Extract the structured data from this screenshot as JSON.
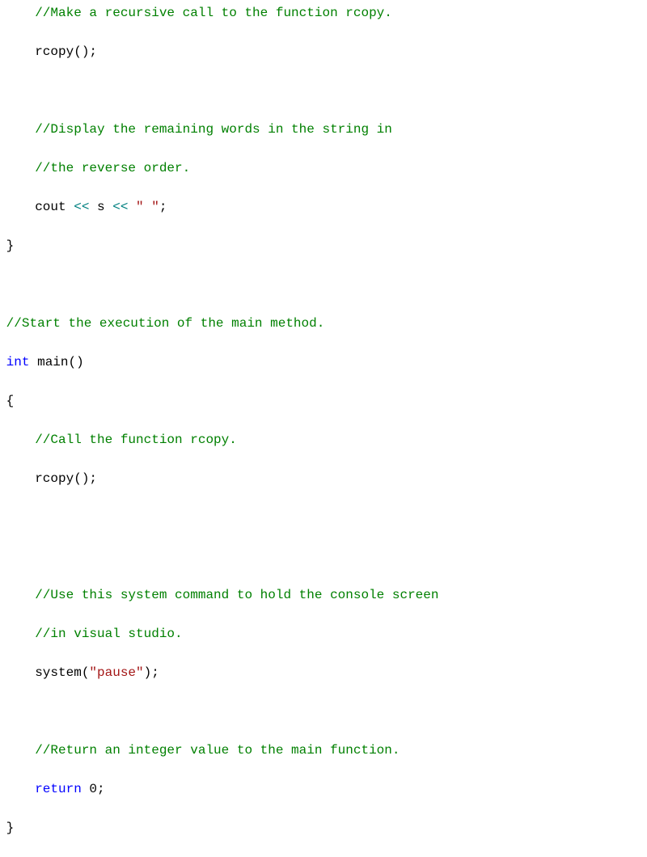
{
  "code": {
    "l1_comment": "//Make a recursive call to the function rcopy.",
    "l2_call": "rcopy",
    "l2_paren": "();",
    "l3_comment": "//Display the remaining words in the string in",
    "l4_comment": "//the reverse order.",
    "l5_cout": "cout ",
    "l5_op1": "<< ",
    "l5_s": "s ",
    "l5_op2": "<< ",
    "l5_str": "\" \"",
    "l5_semi": ";",
    "l6_brace": "}",
    "l7_comment": "//Start the execution of the main method.",
    "l8_int": "int",
    "l8_main": " main()",
    "l9_brace": "{",
    "l10_comment": "//Call the function rcopy.",
    "l11_call": "rcopy",
    "l11_paren": "();",
    "l12_comment": "//Use this system command to hold the console screen",
    "l13_comment": "//in visual studio.",
    "l14_sys": "system(",
    "l14_str": "\"pause\"",
    "l14_end": ");",
    "l15_comment": "//Return an integer value to the main function.",
    "l16_return": "return",
    "l16_zero": " 0",
    "l16_semi": ";",
    "l17_brace": "}"
  }
}
